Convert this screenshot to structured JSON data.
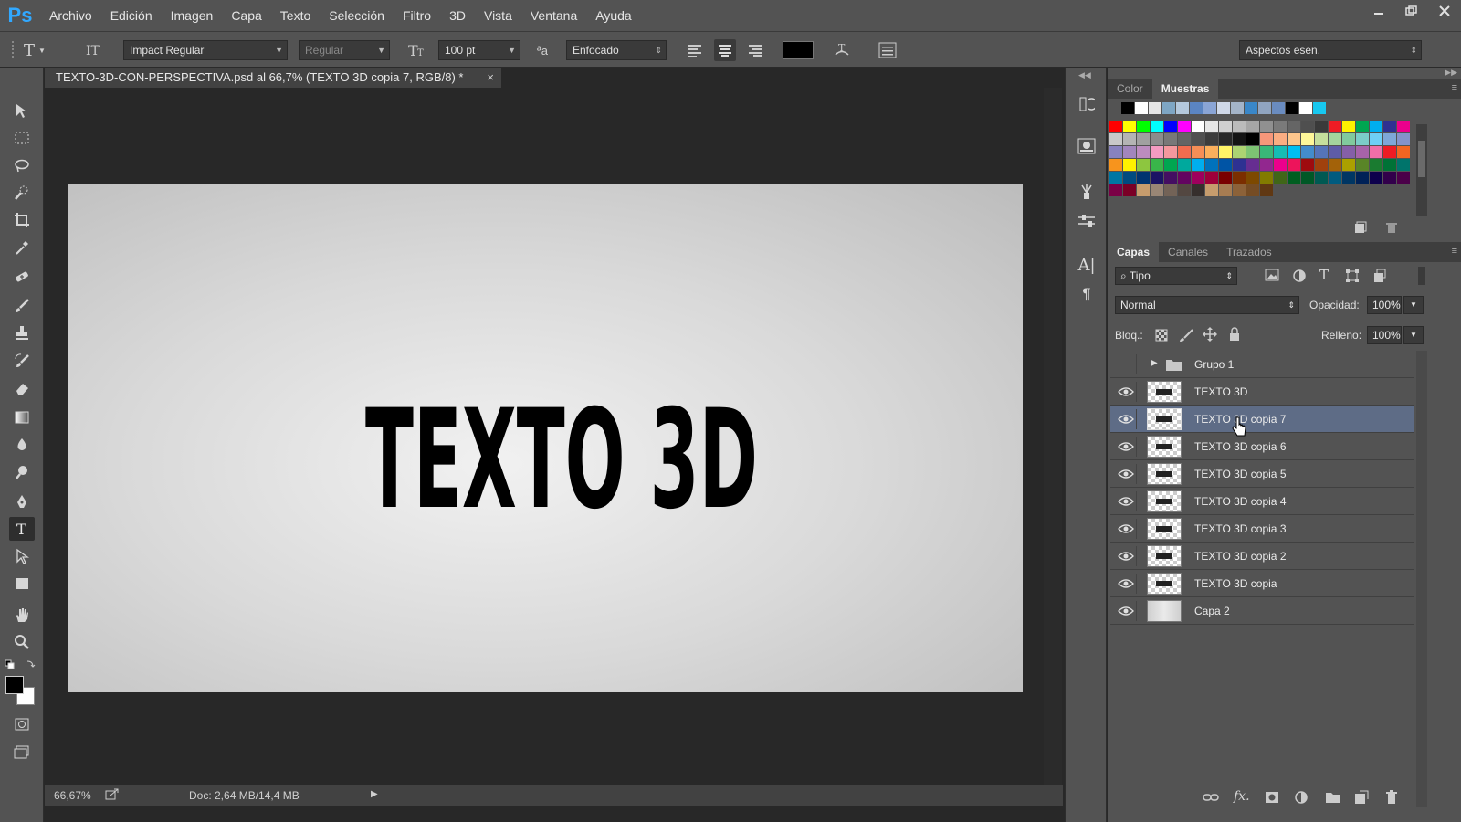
{
  "app": {
    "logo": "Ps"
  },
  "menu": [
    "Archivo",
    "Edición",
    "Imagen",
    "Capa",
    "Texto",
    "Selección",
    "Filtro",
    "3D",
    "Vista",
    "Ventana",
    "Ayuda"
  ],
  "options": {
    "font_family": "Impact Regular",
    "font_style": "Regular",
    "font_size": "100 pt",
    "aa_label": "ªa",
    "antialias": "Enfocado",
    "workspace": "Aspectos esen."
  },
  "document": {
    "tab_title": "TEXTO-3D-CON-PERSPECTIVA.psd al 66,7% (TEXTO 3D copia 7, RGB/8) *",
    "canvas_text": "TEXTO 3D"
  },
  "status": {
    "zoom": "66,67%",
    "doc_info": "Doc: 2,64 MB/14,4 MB"
  },
  "swatches_panel": {
    "tabs": [
      "Color",
      "Muestras"
    ],
    "active_tab": "Muestras",
    "colors_row1": [
      "#000000",
      "#ffffff",
      "#e6e6e6",
      "#7ea6c4",
      "#b4c8dc",
      "#5b85c2",
      "#8aa5d6",
      "#cfd8e8",
      "#a4b4c8",
      "#3a87c8",
      "#90a4c0",
      "#6a8cc0",
      "#000000",
      "#ffffff",
      "#17c8f0"
    ],
    "colors_grid": [
      [
        "#ff0000",
        "#ffff00",
        "#00ff00",
        "#00ffff",
        "#0000ff",
        "#ff00ff",
        "#ffffff",
        "#e6e6e6",
        "#d0d0d0",
        "#bbbbbb",
        "#a6a6a6",
        "#909090",
        "#7a7a7a",
        "#656565",
        "#4f4f4f",
        "#3a3a3a",
        "#ee1c24",
        "#fff200",
        "#00a651",
        "#00aeef",
        "#2e3192",
        "#ec008c"
      ],
      [
        "#c8c8c8",
        "#b4b4b4",
        "#a0a0a0",
        "#8c8c8c",
        "#787878",
        "#646464",
        "#505050",
        "#3c3c3c",
        "#282828",
        "#141414",
        "#000000",
        "#f7977a",
        "#fbad82",
        "#fdc68c",
        "#fff799",
        "#c6df9c",
        "#a4d49d",
        "#81ca9d",
        "#7bcdc8",
        "#6ecff6",
        "#7ea7d8",
        "#8493ca"
      ],
      [
        "#8882be",
        "#a286bd",
        "#bc8cbf",
        "#f49bc1",
        "#f5989d",
        "#f26c4f",
        "#f68e56",
        "#fbaf5c",
        "#fff467",
        "#acd372",
        "#7dc473",
        "#39b778",
        "#16bcb4",
        "#00bff3",
        "#438ccb",
        "#5574b9",
        "#5e5ca7",
        "#855fa8",
        "#a763a9",
        "#ef6ea8",
        "#ed1c24",
        "#f26522"
      ],
      [
        "#f7941d",
        "#fff200",
        "#8dc63f",
        "#39b54a",
        "#00a651",
        "#00a99d",
        "#00aeef",
        "#0072bc",
        "#0054a5",
        "#2e3192",
        "#662d91",
        "#92278f",
        "#ec008c",
        "#ed145b",
        "#9e0b0f",
        "#a0410d",
        "#a36209",
        "#aba000",
        "#598527",
        "#1a7b30",
        "#007236",
        "#00746b"
      ],
      [
        "#0076a3",
        "#004b80",
        "#003370",
        "#1b1464",
        "#440e62",
        "#630460",
        "#9e005d",
        "#9e0039",
        "#790000",
        "#7b2e00",
        "#7d4900",
        "#827b00",
        "#406618",
        "#005e20",
        "#005826",
        "#005952",
        "#005b7f",
        "#003663",
        "#002157",
        "#0d004c",
        "#32004b",
        "#4b0049"
      ],
      [
        "#7b0046",
        "#7a0026",
        "#c69c6d",
        "#998675",
        "#736357",
        "#534741",
        "#362f2d",
        "#c69c6d",
        "#a67c52",
        "#8c6239",
        "#754c24",
        "#603813"
      ]
    ]
  },
  "layers_panel": {
    "tabs": [
      "Capas",
      "Canales",
      "Trazados"
    ],
    "active_tab": "Capas",
    "filter_kind": "Tipo",
    "blend_mode": "Normal",
    "opacity_label": "Opacidad:",
    "opacity_value": "100%",
    "lock_label": "Bloq.:",
    "fill_label": "Relleno:",
    "fill_value": "100%",
    "group": {
      "name": "Grupo 1"
    },
    "layers": [
      {
        "name": "TEXTO 3D",
        "selected": false,
        "thumb": "text"
      },
      {
        "name": "TEXTO 3D copia 7",
        "selected": true,
        "thumb": "text"
      },
      {
        "name": "TEXTO 3D copia 6",
        "selected": false,
        "thumb": "text"
      },
      {
        "name": "TEXTO 3D copia 5",
        "selected": false,
        "thumb": "text"
      },
      {
        "name": "TEXTO 3D copia 4",
        "selected": false,
        "thumb": "text"
      },
      {
        "name": "TEXTO 3D copia 3",
        "selected": false,
        "thumb": "text"
      },
      {
        "name": "TEXTO 3D copia 2",
        "selected": false,
        "thumb": "text"
      },
      {
        "name": "TEXTO 3D copia",
        "selected": false,
        "thumb": "text"
      },
      {
        "name": "Capa 2",
        "selected": false,
        "thumb": "gradient"
      }
    ]
  },
  "colors": {
    "accent_selected_layer": "#5e6c86",
    "foreground": "#000000",
    "background": "#ffffff",
    "text_color_swatch": "#000000"
  }
}
